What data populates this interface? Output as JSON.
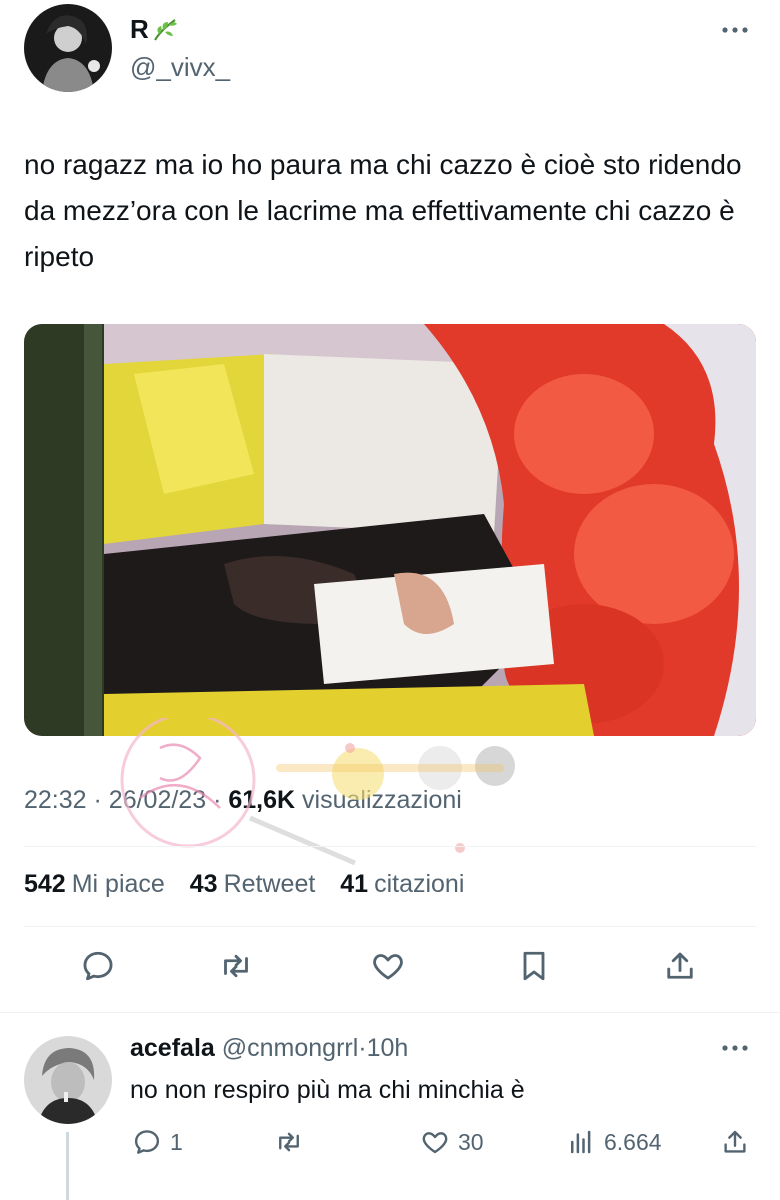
{
  "tweet": {
    "display_name": "R",
    "handle": "@_vivx_",
    "text": "no ragazz ma io ho paura ma chi cazzo è cioè sto ridendo da mezz’ora con le lacrime ma effettivamente chi cazzo è ripeto",
    "time": "22:32",
    "date": "26/02/23",
    "views_count": "61,6K",
    "views_label": "visualizzazioni",
    "stats": [
      {
        "count": "542",
        "label": "Mi piace"
      },
      {
        "count": "43",
        "label": "Retweet"
      },
      {
        "count": "41",
        "label": "citazioni"
      }
    ],
    "actions": [
      "reply-icon",
      "retweet-icon",
      "like-icon",
      "bookmark-icon",
      "share-icon"
    ]
  },
  "reply": {
    "name": "acefala",
    "handle": "@cnmongrrl",
    "time": "10h",
    "text": "no non respiro più ma chi minchia è",
    "reply_count": "1",
    "like_count": "30",
    "views_count": "6.664"
  },
  "colors": {
    "text_primary": "#0f1419",
    "text_secondary": "#536471",
    "divider": "#eff3f4"
  }
}
